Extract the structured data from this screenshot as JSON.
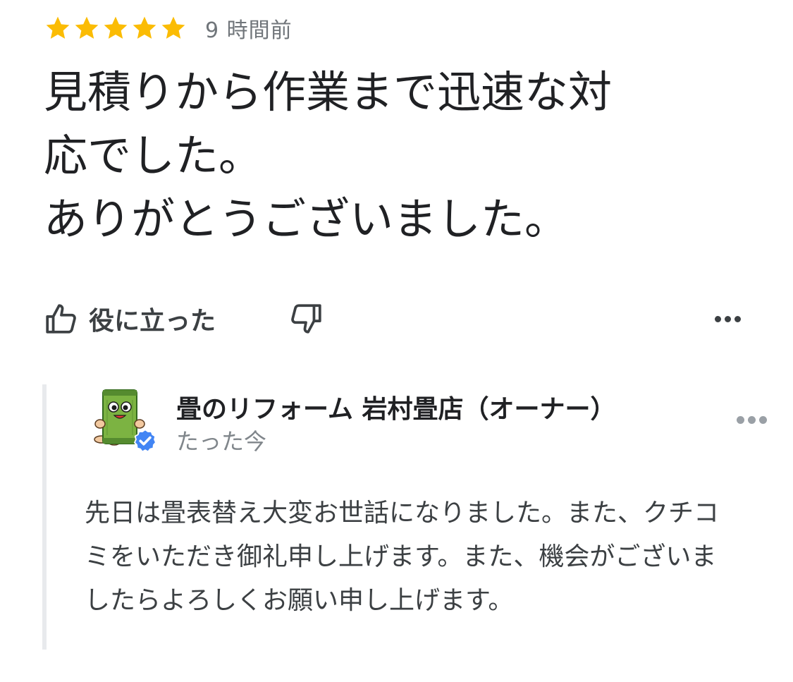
{
  "review": {
    "rating": 5,
    "rating_max": 5,
    "star_color": "#fbbc04",
    "time_ago": "9 時間前",
    "text": "見積りから作業まで迅速な対\n応でした。\nありがとうございました。"
  },
  "actions": {
    "helpful_label": "役に立った",
    "helpful_icon": "thumb-up-icon",
    "not_helpful_icon": "thumb-down-icon",
    "more_icon": "more-horiz-icon"
  },
  "reply": {
    "owner_name": "畳のリフォーム 岩村畳店（オーナー）",
    "time": "たった今",
    "avatar_icon": "tatami-mascot-avatar",
    "verified_icon": "verified-check-icon",
    "verified_color": "#4285f4",
    "text": "先日は畳表替え大変お世話になりました。また、クチコミをいただき御礼申し上げます。また、機会がございましたらよろしくお願い申し上げます。",
    "more_icon": "more-horiz-icon"
  }
}
